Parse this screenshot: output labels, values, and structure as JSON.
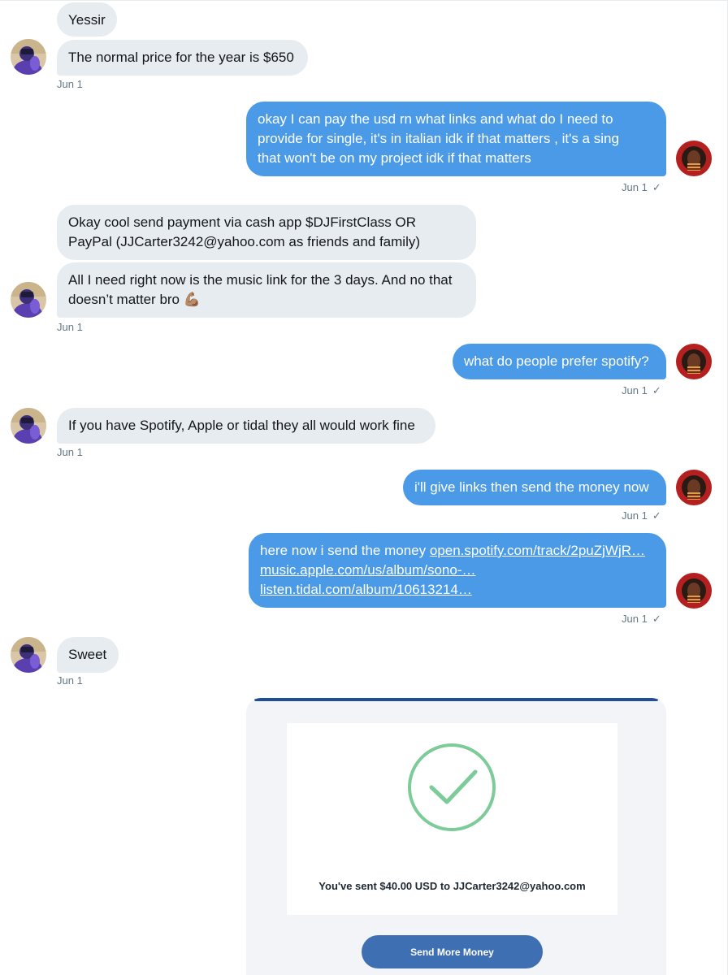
{
  "conversation": {
    "messages": [
      {
        "direction": "in",
        "text": "Yessir"
      },
      {
        "direction": "in",
        "text": "The normal price for the year is $650"
      },
      {
        "direction": "out",
        "lines": [
          "okay I can pay the usd rn what links and what do I need to",
          "provide for single, it's in italian idk if that matters , it's a sing",
          "that won't be on my project idk if that matters"
        ]
      },
      {
        "direction": "in",
        "lines": [
          "Okay cool send payment via cash app $DJFirstClass OR",
          "PayPal (JJCarter3242@yahoo.com as friends and family)"
        ]
      },
      {
        "direction": "in",
        "lines": [
          "All I need right now is the music link for the 3 days. And no that",
          "doesn’t matter bro 💪🏽"
        ]
      },
      {
        "direction": "out",
        "text": "what do people prefer spotify?"
      },
      {
        "direction": "in",
        "text": "If you have Spotify, Apple or tidal they all would work fine"
      },
      {
        "direction": "out",
        "text": "i'll give links then send the money now"
      },
      {
        "direction": "out",
        "prefix": "here now i send the money ",
        "links": [
          "open.spotify.com/track/2puZjWjR…",
          "music.apple.com/us/album/sono-…",
          "listen.tidal.com/album/10613214…"
        ]
      },
      {
        "direction": "in",
        "text": "Sweet"
      }
    ],
    "timestamps": {
      "date": "Jun 1",
      "read_check": "✓"
    }
  },
  "payment_card": {
    "success_message": "You've sent $40.00 USD to JJCarter3242@yahoo.com",
    "button_label": "Send More Money",
    "check_color": "#7ccb98",
    "button_color": "#3f6fb3",
    "topbar_color": "#1f4e96"
  },
  "colors": {
    "incoming_bubble": "#e6ecf0",
    "outgoing_bubble": "#4a9ae8",
    "timestamp_text": "#657786"
  },
  "icons": {
    "their_avatar": "purple-figure-avatar-icon",
    "my_avatar": "red-portrait-avatar-icon",
    "read_receipt": "checkmark-icon",
    "success": "check-circle-icon"
  }
}
